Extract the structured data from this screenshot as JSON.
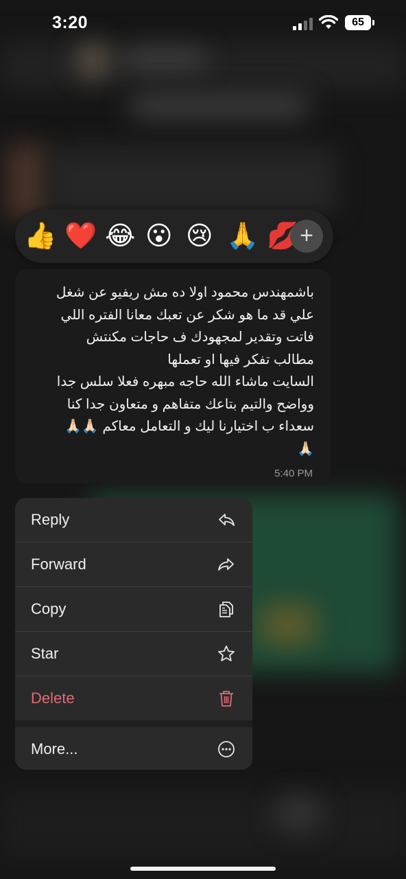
{
  "status_bar": {
    "time": "3:20",
    "battery": "65"
  },
  "reactions": {
    "emojis": [
      "👍",
      "❤️",
      "😂",
      "😮",
      "😢",
      "🙏",
      "💋"
    ],
    "add_label": "+"
  },
  "message": {
    "text": "باشمهندس محمود اولا ده مش ريفيو عن شغل\nعلي قد ما هو شكر عن تعبك معانا الفتره اللي\nفاتت وتقدير لمجهودك ف حاجات مكنتش\nمطالب تفكر فيها او تعملها\nالسايت ماشاء الله حاجه مبهره فعلا سلس جدا\nوواضح والتيم بتاعك متفاهم و متعاون جدا كنا\nسعداء ب اختيارنا ليك و التعامل معاكم 🙏🏻🙏🏻\n🙏🏻",
    "time": "5:40 PM"
  },
  "menu": {
    "reply": "Reply",
    "forward": "Forward",
    "copy": "Copy",
    "star": "Star",
    "delete": "Delete",
    "more": "More...",
    "icons": [
      "reply-icon",
      "forward-icon",
      "copy-icon",
      "star-icon",
      "trash-icon",
      "more-icon"
    ]
  },
  "colors": {
    "delete": "#e36a74",
    "menu_bg": "#2a2a2a",
    "bubble_bg": "#1b1b1b"
  }
}
